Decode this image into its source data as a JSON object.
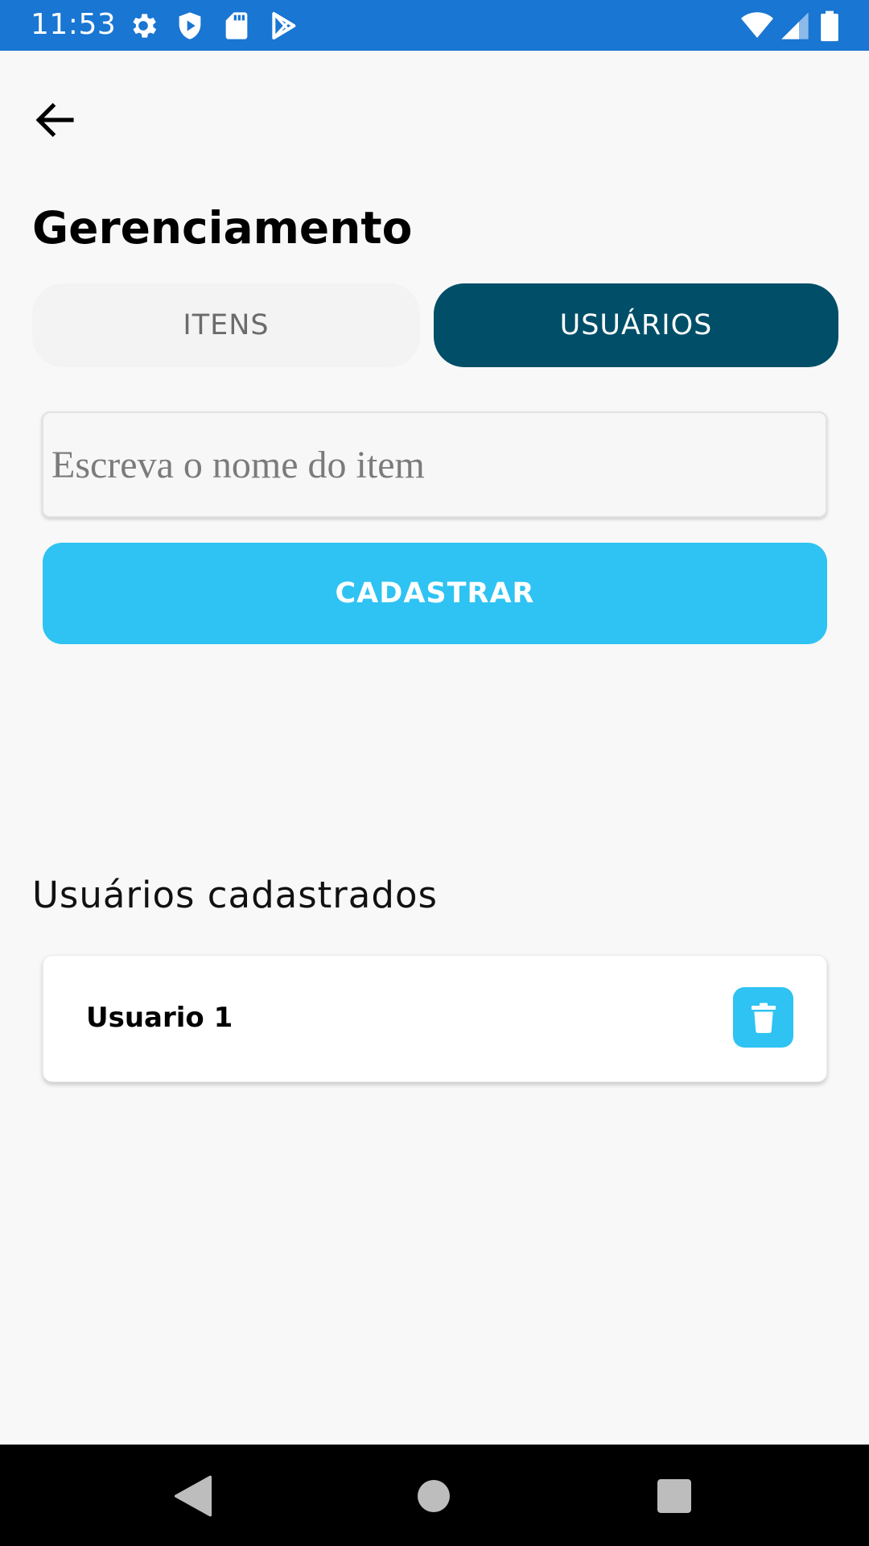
{
  "status_bar": {
    "time": "11:53",
    "icons": [
      "gear-icon",
      "shield-icon",
      "sd-card-icon",
      "play-store-icon",
      "wifi-icon",
      "signal-icon",
      "battery-icon"
    ],
    "background": "#1976d2"
  },
  "header": {
    "back_icon": "arrow-back-icon",
    "title": "Gerenciamento"
  },
  "tabs": [
    {
      "label": "ITENS",
      "selected": false
    },
    {
      "label": "USUÁRIOS",
      "selected": true
    }
  ],
  "form": {
    "input_placeholder": "Escreva o nome do item",
    "input_value": "",
    "submit_label": "CADASTRAR"
  },
  "users_section": {
    "heading": "Usuários cadastrados",
    "items": [
      {
        "name": "Usuario 1",
        "action_icon": "trash-icon"
      }
    ]
  },
  "nav_bar": {
    "icons": [
      "back-triangle-icon",
      "home-circle-icon",
      "recents-square-icon"
    ]
  },
  "colors": {
    "accent": "#2ec3f2",
    "selected_tab": "#004e68",
    "background": "#f8f8f8"
  }
}
